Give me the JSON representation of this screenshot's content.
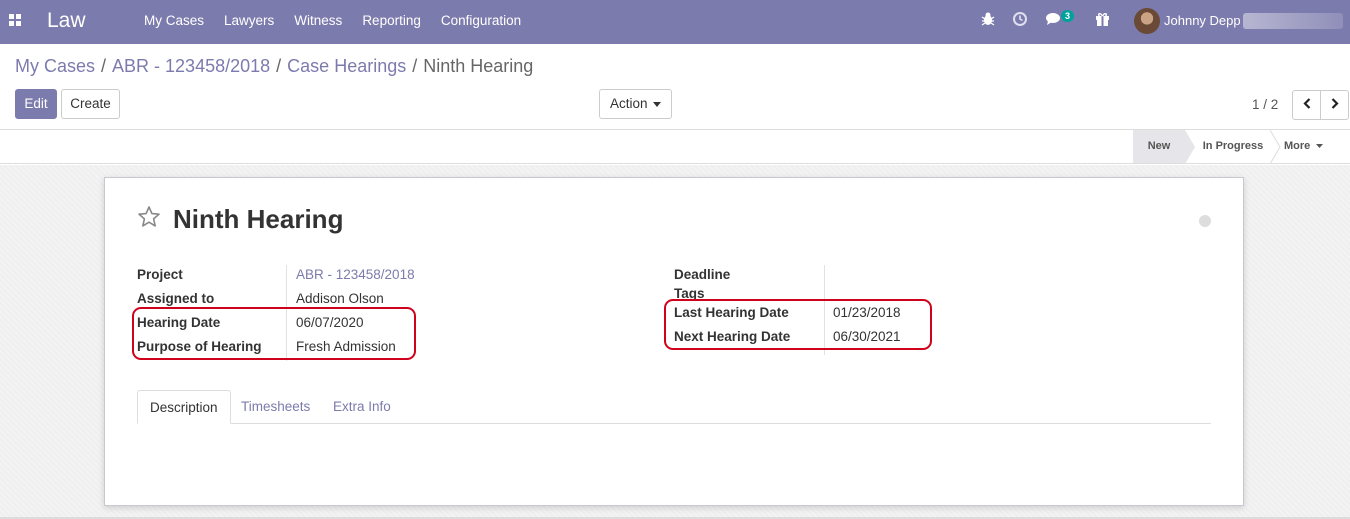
{
  "navbar": {
    "brand": "Law",
    "menu": [
      "My Cases",
      "Lawyers",
      "Witness",
      "Reporting",
      "Configuration"
    ],
    "icons": [
      "apps-grid-icon",
      "bug-icon",
      "clock-icon",
      "chat-icon",
      "gift-icon"
    ],
    "chat_badge": "3",
    "user_name": "Johnny Depp"
  },
  "breadcrumb": {
    "items": [
      "My Cases",
      "ABR - 123458/2018",
      "Case Hearings"
    ],
    "separator": "/",
    "current": "Ninth Hearing"
  },
  "control": {
    "edit_label": "Edit",
    "create_label": "Create",
    "action_label": "Action",
    "pager": "1 / 2"
  },
  "status": {
    "stages": [
      "New",
      "In Progress"
    ],
    "more_label": "More",
    "current": "New"
  },
  "record": {
    "title": "Ninth Hearing",
    "left_fields": [
      {
        "label": "Project",
        "value": "ABR - 123458/2018"
      },
      {
        "label": "Assigned to",
        "value": "Addison Olson"
      },
      {
        "label": "Hearing Date",
        "value": "06/07/2020"
      },
      {
        "label": "Purpose of Hearing",
        "value": "Fresh Admission"
      }
    ],
    "right_fields": [
      {
        "label": "Deadline",
        "value": ""
      },
      {
        "label": "Tags",
        "value": ""
      },
      {
        "label": "Last Hearing Date",
        "value": "01/23/2018"
      },
      {
        "label": "Next Hearing Date",
        "value": "06/30/2021"
      }
    ]
  },
  "tabs": [
    "Description",
    "Timesheets",
    "Extra Info"
  ],
  "colors": {
    "brand": "#7c7bad",
    "highlight": "#d0021b",
    "badge": "#00a09d"
  }
}
